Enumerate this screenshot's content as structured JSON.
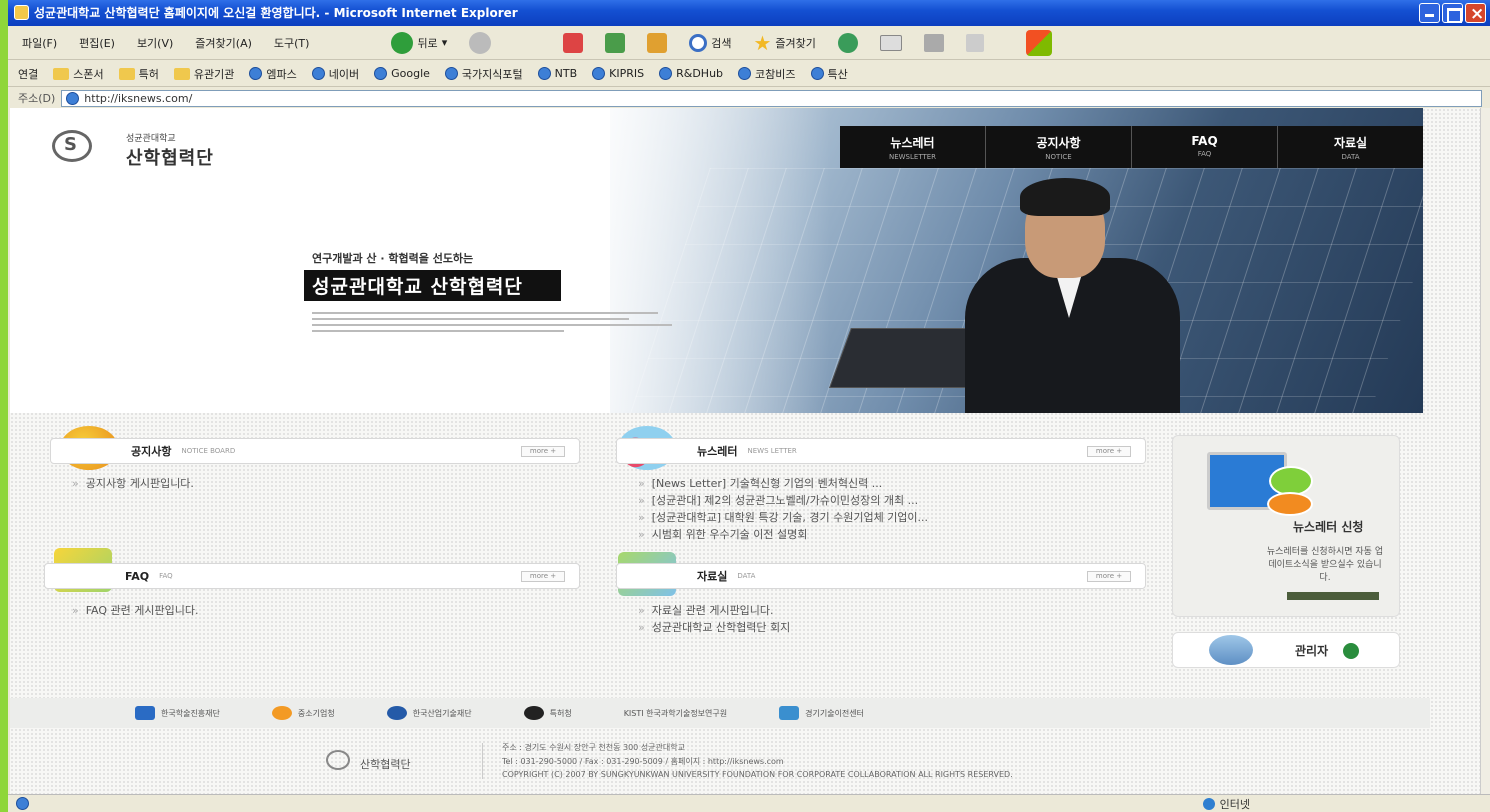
{
  "window": {
    "title": "성균관대학교 산학협력단 홈페이지에 오신걸 환영합니다. - Microsoft Internet Explorer"
  },
  "menubar": {
    "items": [
      "파일(F)",
      "편집(E)",
      "보기(V)",
      "즐겨찾기(A)",
      "도구(T)"
    ],
    "back": "뒤로",
    "search": "검색",
    "favorites": "즐겨찾기"
  },
  "linksbar": {
    "label": "연결",
    "links": [
      "스폰서",
      "특허",
      "유관기관",
      "엠파스",
      "네이버",
      "Google",
      "국가지식포털",
      "NTB",
      "KIPRIS",
      "R&DHub",
      "코참비즈",
      "특산"
    ]
  },
  "address": {
    "label": "주소(D)",
    "url": "http://iksnews.com/"
  },
  "site": {
    "logo_sub": "성균관대학교",
    "logo_main": "산학협력단",
    "nav": [
      {
        "label": "뉴스레터",
        "sub": "NEWSLETTER"
      },
      {
        "label": "공지사항",
        "sub": "NOTICE"
      },
      {
        "label": "FAQ",
        "sub": "FAQ"
      },
      {
        "label": "자료실",
        "sub": "DATA"
      }
    ],
    "slogan_sub": "연구개발과 산 · 학협력을 선도하는",
    "slogan_main": "성균관대학교 산학협력단"
  },
  "boards": {
    "notice": {
      "title": "공지사항",
      "en": "NOTICE BOARD",
      "more": "more +",
      "items": [
        "공지사항 게시판입니다."
      ]
    },
    "news": {
      "title": "뉴스레터",
      "en": "NEWS LETTER",
      "more": "more +",
      "items": [
        "[News Letter] 기술혁신형 기업의 벤처혁신력 ...",
        "[성균관대] 제2의 성균관그노벨레/가슈이민성장의 개최 ...",
        "[성균관대학교] 대학원 특강 기술, 경기 수원기업체 기업이...",
        "시범회 위한 우수기술 이전 설명회"
      ]
    },
    "faq": {
      "title": "FAQ",
      "en": "FAQ",
      "more": "more +",
      "items": [
        "FAQ 관련 게시판입니다."
      ]
    },
    "data": {
      "title": "자료실",
      "en": "DATA",
      "more": "more +",
      "items": [
        "자료실 관련 게시판입니다.",
        "성균관대학교 산학협력단 회지"
      ]
    }
  },
  "sidebar": {
    "newsletter_title": "뉴스레터 신청",
    "newsletter_body": "뉴스레터를 신청하시면 자동 업데이트소식을 받으실수 있습니다.",
    "admin_label": "관리자"
  },
  "partners": [
    "한국학술진흥재단",
    "중소기업청",
    "한국산업기술재단",
    "특허청",
    "KISTI 한국과학기술정보연구원",
    "경기기술이전센터"
  ],
  "footer": {
    "name": "산학협력단",
    "line1": "주소 : 경기도 수원시 장안구 천천동 300 성균관대학교",
    "line2": "Tel : 031-290-5000 / Fax : 031-290-5009 / 홈페이지 : http://iksnews.com",
    "line3": "COPYRIGHT (C) 2007 BY SUNGKYUNKWAN UNIVERSITY FOUNDATION FOR CORPORATE COLLABORATION ALL RIGHTS RESERVED."
  },
  "status": {
    "zone": "인터넷"
  }
}
